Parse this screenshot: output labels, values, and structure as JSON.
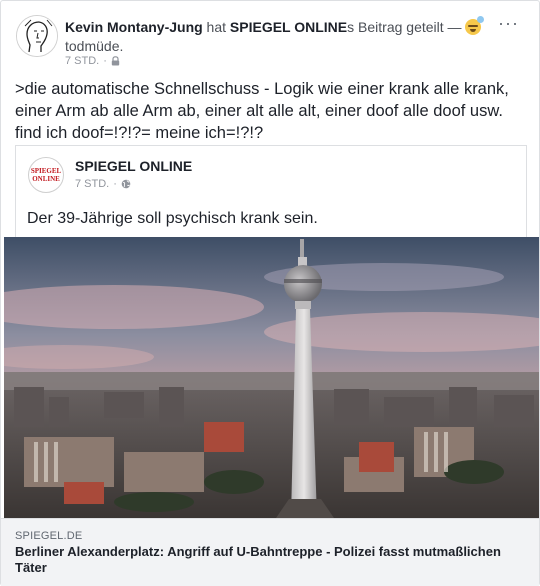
{
  "post": {
    "author": "Kevin Montany-Jung",
    "action_pre": " hat ",
    "shared_page": "SPIEGEL ONLINE",
    "action_post": "s Beitrag geteilt — ",
    "feeling": " todmüde.",
    "time": "7 STD.",
    "separator": "·",
    "text": ">die automatische Schnellschuss - Logik wie einer krank alle krank, einer Arm ab alle Arm ab, einer alt alle alt, einer doof alle doof usw. find ich doof=!?!?= meine ich=!?!?",
    "more_icon": "more-options-icon",
    "privacy_icon": "lock-icon"
  },
  "shared": {
    "page_name": "SPIEGEL ONLINE",
    "logo_line1": "SPIEGEL",
    "logo_line2": "ONLINE",
    "time": "7 STD.",
    "separator": "·",
    "privacy_icon": "globe-icon",
    "text": "Der 39-Jährige soll psychisch krank sein."
  },
  "link": {
    "domain": "SPIEGEL.DE",
    "headline": "Berliner Alexanderplatz: Angriff auf U-Bahntreppe - Polizei fasst mutmaßlichen Täter"
  },
  "colors": {
    "text": "#1d2129",
    "muted": "#90949c",
    "border": "#dddfe2",
    "footer_bg": "#f2f3f5",
    "spiegel_red": "#c2181e"
  }
}
